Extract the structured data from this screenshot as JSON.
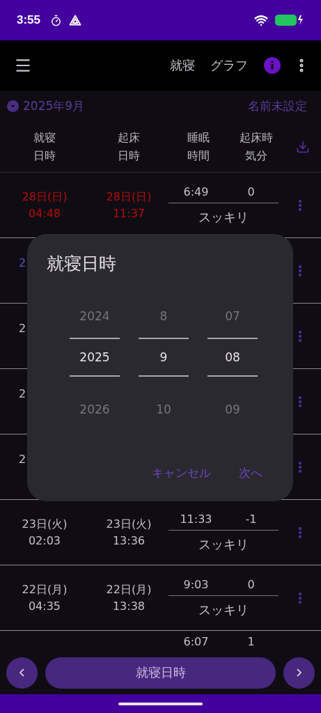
{
  "status_bar": {
    "time": "3:55"
  },
  "app_bar": {
    "actions": [
      {
        "label": "就寝"
      },
      {
        "label": "グラフ"
      }
    ]
  },
  "month": {
    "label": "2025年9月",
    "name": "名前未設定"
  },
  "columns": [
    {
      "lines": [
        "就寝",
        "日時"
      ]
    },
    {
      "lines": [
        "起床",
        "日時"
      ]
    },
    {
      "lines": [
        "睡眠",
        "時間"
      ]
    },
    {
      "lines": [
        "起床時",
        "気分"
      ]
    }
  ],
  "rows": [
    {
      "kind": "full",
      "bed_date": "28日(日)",
      "bed_time": "04:48",
      "wake_date": "28日(日)",
      "wake_time": "11:37",
      "duration": "6:49",
      "mood_score": "0",
      "mood": "スッキリ",
      "color": "#b40c0c"
    },
    {
      "kind": "covered",
      "bed_date": "2",
      "color": "#5a52cc"
    },
    {
      "kind": "covered",
      "bed_date": "2",
      "color": "#c4c2c8"
    },
    {
      "kind": "covered",
      "bed_date": "2",
      "color": "#c4c2c8"
    },
    {
      "kind": "covered",
      "bed_date": "2",
      "color": "#c4c2c8"
    },
    {
      "kind": "full",
      "bed_date": "23日(火)",
      "bed_time": "02:03",
      "wake_date": "23日(火)",
      "wake_time": "13:36",
      "duration": "11:33",
      "mood_score": "-1",
      "mood": "スッキリ",
      "color": "#c4c2c8"
    },
    {
      "kind": "full",
      "bed_date": "22日(月)",
      "bed_time": "04:35",
      "wake_date": "22日(月)",
      "wake_time": "13:38",
      "duration": "9:03",
      "mood_score": "0",
      "mood": "スッキリ",
      "color": "#c4c2c8"
    },
    {
      "kind": "partial",
      "duration": "6:07",
      "mood_score": "1"
    }
  ],
  "picker": {
    "title": "就寝日時",
    "columns": [
      {
        "above": "2024",
        "value": "2025",
        "below": "2026"
      },
      {
        "above": "8",
        "value": "9",
        "below": "10"
      },
      {
        "above": "07",
        "value": "08",
        "below": "09"
      }
    ],
    "buttons": [
      "キャンセル",
      "次へ"
    ]
  },
  "bottom_bar": {
    "label": "就寝日時"
  }
}
